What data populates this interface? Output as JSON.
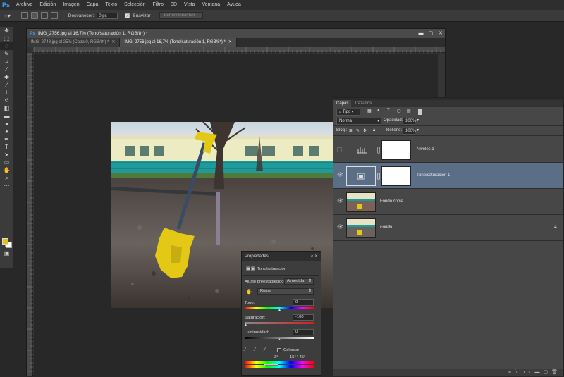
{
  "menubar": {
    "logo": "Ps",
    "items": [
      "Archivo",
      "Edición",
      "Imagen",
      "Capa",
      "Texto",
      "Selección",
      "Filtro",
      "3D",
      "Vista",
      "Ventana",
      "Ayuda"
    ]
  },
  "options": {
    "feather_label": "Desvanecer:",
    "feather_value": "0 px",
    "smooth_label": "Suavizar",
    "refine_edge": "Perfeccionar bor..."
  },
  "document": {
    "title": "IMG_2756.jpg al 16,7% (Tono/saturación 1, RGB/8*) *",
    "tabs": [
      {
        "label": "IMG_2748.jpg al 25% (Capa 0, RGB/8*) *",
        "active": false
      },
      {
        "label": "IMG_2756.jpg al 16,7% (Tono/saturación 1, RGB/8*) *",
        "active": true
      }
    ]
  },
  "layers_panel": {
    "tabs": [
      "Capas",
      "Trazados"
    ],
    "kind_filter": "Tipo",
    "blend_mode": "Normal",
    "opacity_label": "Opacidad:",
    "opacity_value": "100%",
    "lock_label": "Bloq.:",
    "fill_label": "Relleno:",
    "fill_value": "100%",
    "layers": [
      {
        "name": "Niveles 1",
        "visible": false,
        "selected": false
      },
      {
        "name": "Tono/saturación 1",
        "visible": true,
        "selected": true
      },
      {
        "name": "Fondo copia",
        "visible": true,
        "selected": false
      },
      {
        "name": "Fondo",
        "visible": true,
        "selected": false,
        "locked": true
      }
    ]
  },
  "properties_panel": {
    "title": "Propiedades",
    "adjustment_name": "Tono/saturación",
    "preset_label": "Ajuste preestablecido:",
    "preset_value": "A medida",
    "channel": "Rojos",
    "hue_label": "Tono:",
    "hue_value": "0",
    "saturation_label": "Saturación:",
    "saturation_value": "-100",
    "lightness_label": "Luminosidad:",
    "lightness_value": "0",
    "colorize_label": "Colorear",
    "range_left": "3°",
    "range_right": "15° \\ 45°"
  },
  "colors": {
    "foreground": "#e0c31a",
    "background": "#ffffff",
    "selection": "#5a6e86"
  }
}
